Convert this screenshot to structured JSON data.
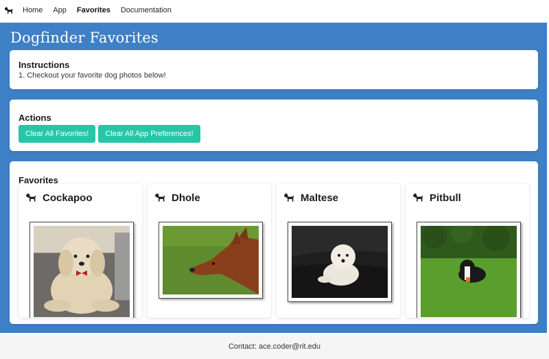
{
  "nav": {
    "items": [
      {
        "label": "Home",
        "active": false
      },
      {
        "label": "App",
        "active": false
      },
      {
        "label": "Favorites",
        "active": true
      },
      {
        "label": "Documentation",
        "active": false
      }
    ]
  },
  "hero": {
    "title": "Dogfinder Favorites"
  },
  "instructions": {
    "title": "Instructions",
    "text": "1. Checkout your favorite dog photos below!"
  },
  "actions": {
    "title": "Actions",
    "clear_favorites_label": "Clear All Favorites!",
    "clear_prefs_label": "Clear All App Preferences!"
  },
  "favorites": {
    "title": "Favorites",
    "cards": [
      {
        "name": "Cockapoo"
      },
      {
        "name": "Dhole"
      },
      {
        "name": "Maltese"
      },
      {
        "name": "Pitbull"
      }
    ]
  },
  "footer": {
    "contact": "Contact: ace.coder@rit.edu"
  },
  "colors": {
    "hero_bg": "#3e80c5",
    "button": "#26c6a6"
  }
}
